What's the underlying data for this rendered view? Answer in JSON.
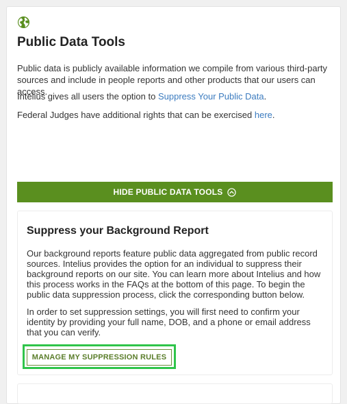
{
  "section": {
    "title": "Public Data Tools",
    "intro": "Public data is publicly available information we compile from various third-party sources and include in people reports and other products that our users can access.",
    "suppress_prefix": "Intelius gives all users the option to ",
    "suppress_link": "Suppress Your Public Data",
    "suppress_suffix": ".",
    "judges_prefix": "Federal Judges have additional rights that can be exercised ",
    "judges_link": "here",
    "judges_suffix": ".",
    "hide_button": "HIDE PUBLIC DATA TOOLS"
  },
  "suppress_card": {
    "title": "Suppress your Background Report",
    "body1": "Our background reports feature public data aggregated from public record sources. Intelius provides the option for an individual to suppress their background reports on our site. You can learn more about Intelius and how this process works in the FAQs at the bottom of this page. To begin the public data suppression process, click the corresponding button below.",
    "body2": "In order to set suppression settings, you will first need to confirm your identity by providing your full name, DOB, and a phone or email address that you can verify.",
    "button": "MANAGE MY SUPPRESSION RULES"
  },
  "colors": {
    "accent_green": "#5a8f1f",
    "link_blue": "#3b7bbf",
    "highlight": "#2fc44a"
  },
  "icons": {
    "header": "globe-icon",
    "hide_button": "chevron-up-circle-icon"
  }
}
